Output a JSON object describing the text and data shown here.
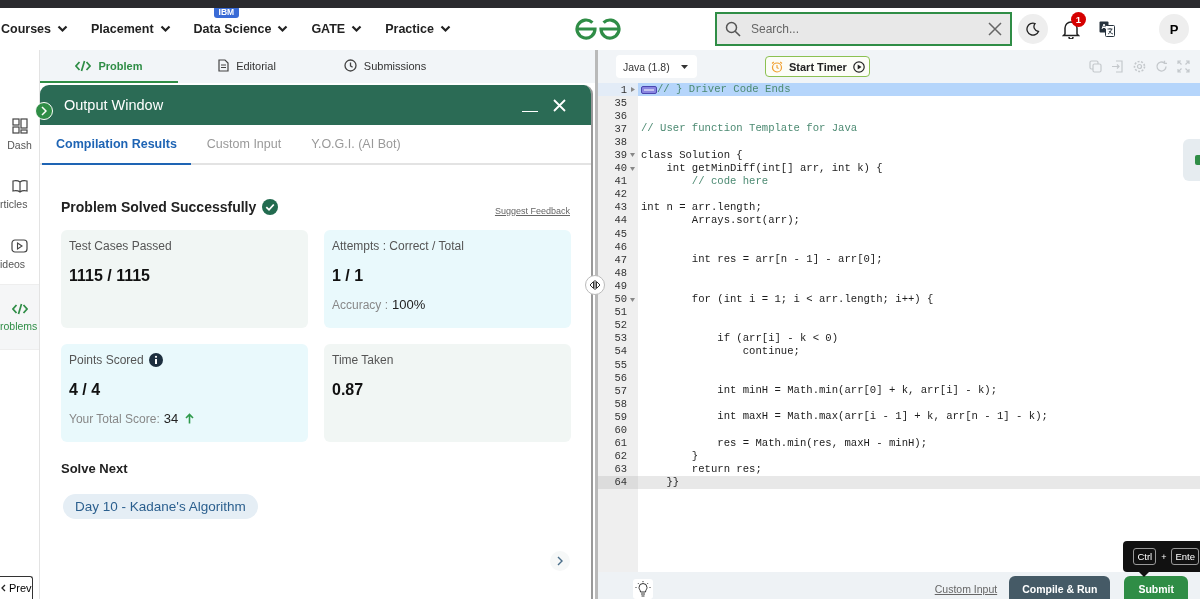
{
  "header": {
    "nav": [
      {
        "label": "Courses"
      },
      {
        "label": "Placement"
      },
      {
        "label": "Data Science",
        "badge": "IBM"
      },
      {
        "label": "GATE"
      },
      {
        "label": "Practice"
      }
    ],
    "search": {
      "placeholder": "Search..."
    },
    "notifications": "1",
    "avatar": "P"
  },
  "sidebar": {
    "items": [
      {
        "label": "Dash",
        "selected": false
      },
      {
        "label": "rticles",
        "selected": false
      },
      {
        "label": "ideos",
        "selected": false
      },
      {
        "label": "roblems",
        "selected": true
      }
    ],
    "prev": "Prev"
  },
  "problem_tabs": [
    {
      "label": "Problem",
      "selected": true
    },
    {
      "label": "Editorial",
      "selected": false
    },
    {
      "label": "Submissions",
      "selected": false
    }
  ],
  "output_window": {
    "title": "Output Window",
    "tabs": [
      {
        "label": "Compilation Results",
        "selected": true
      },
      {
        "label": "Custom Input",
        "selected": false
      },
      {
        "label": "Y.O.G.I. (AI Bot)",
        "selected": false
      }
    ],
    "status": "Problem Solved Successfully",
    "feedback_link": "Suggest Feedback",
    "cards": [
      {
        "label": "Test Cases Passed",
        "info": false,
        "value": "1115 / 1115",
        "color": "#f1f6f4"
      },
      {
        "label": "Attempts : Correct / Total",
        "info": false,
        "value": "1 / 1",
        "note_label": "Accuracy :",
        "note_value": "100%",
        "rising": false,
        "color": "#e9f9fc"
      },
      {
        "label": "Points Scored",
        "info": true,
        "value": "4 / 4",
        "note_label": "Your Total Score:",
        "note_value": "34",
        "rising": true,
        "color": "#e9f9fc"
      },
      {
        "label": "Time Taken",
        "info": false,
        "value": "0.87",
        "color": "#f1f6f4"
      }
    ],
    "solve_next": {
      "heading": "Solve Next",
      "items": [
        "Day 10 - Kadane's Algorithm"
      ]
    }
  },
  "editor": {
    "language": "Java (1.8)",
    "timer_button": "Start Timer",
    "lines": [
      {
        "n": "1",
        "expanded": false,
        "selected": true,
        "active": false,
        "kind": "comment",
        "text": "// } Driver Code Ends"
      },
      {
        "n": "35",
        "selected": false,
        "active": false
      },
      {
        "n": "36",
        "selected": false,
        "active": false
      },
      {
        "n": "37",
        "selected": false,
        "active": false,
        "kind": "comment",
        "text": "// User function Template for Java"
      },
      {
        "n": "38",
        "selected": false,
        "active": false
      },
      {
        "n": "39",
        "expanded": true,
        "selected": false,
        "active": false,
        "kind": "code",
        "text": "class Solution {"
      },
      {
        "n": "40",
        "expanded": true,
        "selected": false,
        "active": false,
        "kind": "code",
        "text": "    int getMinDiff(int[] arr, int k) {"
      },
      {
        "n": "41",
        "selected": false,
        "active": false,
        "kind": "comment",
        "text": "        // code here"
      },
      {
        "n": "42",
        "selected": false,
        "active": false
      },
      {
        "n": "43",
        "selected": false,
        "active": false,
        "kind": "code",
        "text": "int n = arr.length;"
      },
      {
        "n": "44",
        "selected": false,
        "active": false,
        "kind": "code",
        "text": "        Arrays.sort(arr);"
      },
      {
        "n": "45",
        "selected": false,
        "active": false
      },
      {
        "n": "46",
        "selected": false,
        "active": false
      },
      {
        "n": "47",
        "selected": false,
        "active": false,
        "kind": "code",
        "text": "        int res = arr[n - 1] - arr[0];"
      },
      {
        "n": "48",
        "selected": false,
        "active": false
      },
      {
        "n": "49",
        "selected": false,
        "active": false
      },
      {
        "n": "50",
        "expanded": true,
        "selected": false,
        "active": false,
        "kind": "code",
        "text": "        for (int i = 1; i < arr.length; i++) {"
      },
      {
        "n": "51",
        "selected": false,
        "active": false
      },
      {
        "n": "52",
        "selected": false,
        "active": false
      },
      {
        "n": "53",
        "selected": false,
        "active": false,
        "kind": "code",
        "text": "            if (arr[i] - k < 0)"
      },
      {
        "n": "54",
        "selected": false,
        "active": false,
        "kind": "code",
        "text": "                continue;"
      },
      {
        "n": "55",
        "selected": false,
        "active": false
      },
      {
        "n": "56",
        "selected": false,
        "active": false
      },
      {
        "n": "57",
        "selected": false,
        "active": false,
        "kind": "code",
        "text": "            int minH = Math.min(arr[0] + k, arr[i] - k);"
      },
      {
        "n": "58",
        "selected": false,
        "active": false
      },
      {
        "n": "59",
        "selected": false,
        "active": false,
        "kind": "code",
        "text": "            int maxH = Math.max(arr[i - 1] + k, arr[n - 1] - k);"
      },
      {
        "n": "60",
        "selected": false,
        "active": false
      },
      {
        "n": "61",
        "selected": false,
        "active": false,
        "kind": "code",
        "text": "            res = Math.min(res, maxH - minH);"
      },
      {
        "n": "62",
        "selected": false,
        "active": false,
        "kind": "code",
        "text": "        }"
      },
      {
        "n": "63",
        "selected": false,
        "active": false,
        "kind": "code",
        "text": "        return res;"
      },
      {
        "n": "64",
        "selected": false,
        "active": true,
        "kind": "code",
        "text": "    }}"
      }
    ],
    "footer": {
      "custom_input": "Custom Input",
      "compile": "Compile & Run",
      "submit": "Submit"
    },
    "tooltip": {
      "keys": [
        "Ctrl",
        "Ente"
      ],
      "joiner": "+"
    }
  }
}
